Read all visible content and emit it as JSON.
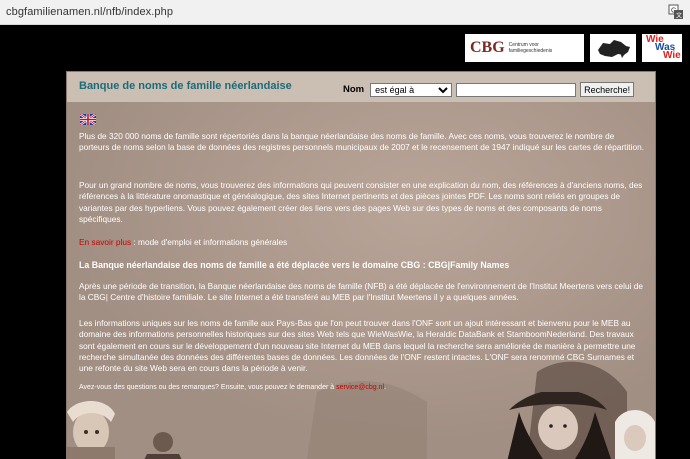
{
  "browser": {
    "url": "cbgfamilienamen.nl/nfb/index.php"
  },
  "logos": {
    "cbg_mark": "CBG",
    "cbg_text": "Centrum voor familiegeschiedenis",
    "wiewaswie": [
      "Wie",
      "Was",
      "Wie"
    ]
  },
  "header": {
    "title": "Banque de noms de famille néerlandaise",
    "search_label": "Nom",
    "select_value": "est égal à",
    "select_options": [
      "est égal à"
    ],
    "search_input": "",
    "search_button": "Recherche!"
  },
  "content": {
    "p1": "Plus de 320 000 noms de famille sont répertoriés dans la banque néerlandaise des noms de famille. Avec ces noms, vous trouverez le nombre de porteurs de noms selon la base de données des registres personnels municipaux de 2007 et le recensement de 1947 indiqué sur les cartes de répartition.",
    "p2": "Pour un grand nombre de noms, vous trouverez des informations qui peuvent consister en une explication du nom, des références à d'anciens noms, des références à la littérature onomastique et généalogique, des sites Internet pertinents et des pièces jointes PDF. Les noms sont reliés en groupes de variantes par des hyperliens. Vous pouvez également créer des liens vers des pages Web sur des types de noms et des composants de noms spécifiques.",
    "p3_link": "En savoir plus",
    "p3_rest": " : mode d'emploi et informations générales",
    "p4": "La Banque néerlandaise des noms de famille a été déplacée vers le domaine CBG : CBG|Family Names",
    "p5": "Après une période de transition, la Banque néerlandaise des noms de famille (NFB) a été déplacée de l'environnement de l'Institut Meertens vers celui de la CBG| Centre d'histoire familiale. Le site Internet a été transféré au MEB par l'Institut Meertens il y a quelques années.",
    "p6": "Les informations uniques sur les noms de famille aux Pays-Bas que l'on peut trouver dans l'ONF sont un ajout intéressant et bienvenu pour le MEB au domaine des informations personnelles historiques sur des sites Web tels que WieWasWie, la Heraldic DataBank et StamboomNederland. Des travaux sont également en cours sur le développement d'un nouveau site Internet du MEB dans lequel la recherche sera améliorée de manière à permettre une recherche simultanée des données des différentes bases de données. Les données de l'ONF restent intactes. L'ONF sera renommé CBG Surnames et une refonte du site Web sera en cours dans la période à venir.",
    "p7": "Avez-vous des questions ou des remarques? Ensuite, vous pouvez le demander à",
    "p7_email": "service@cbg.nl",
    "p7_end": "."
  },
  "colors": {
    "title": "#1c6b7a",
    "panel_bg": "#c7b9ad",
    "link_red": "#cc0000"
  }
}
